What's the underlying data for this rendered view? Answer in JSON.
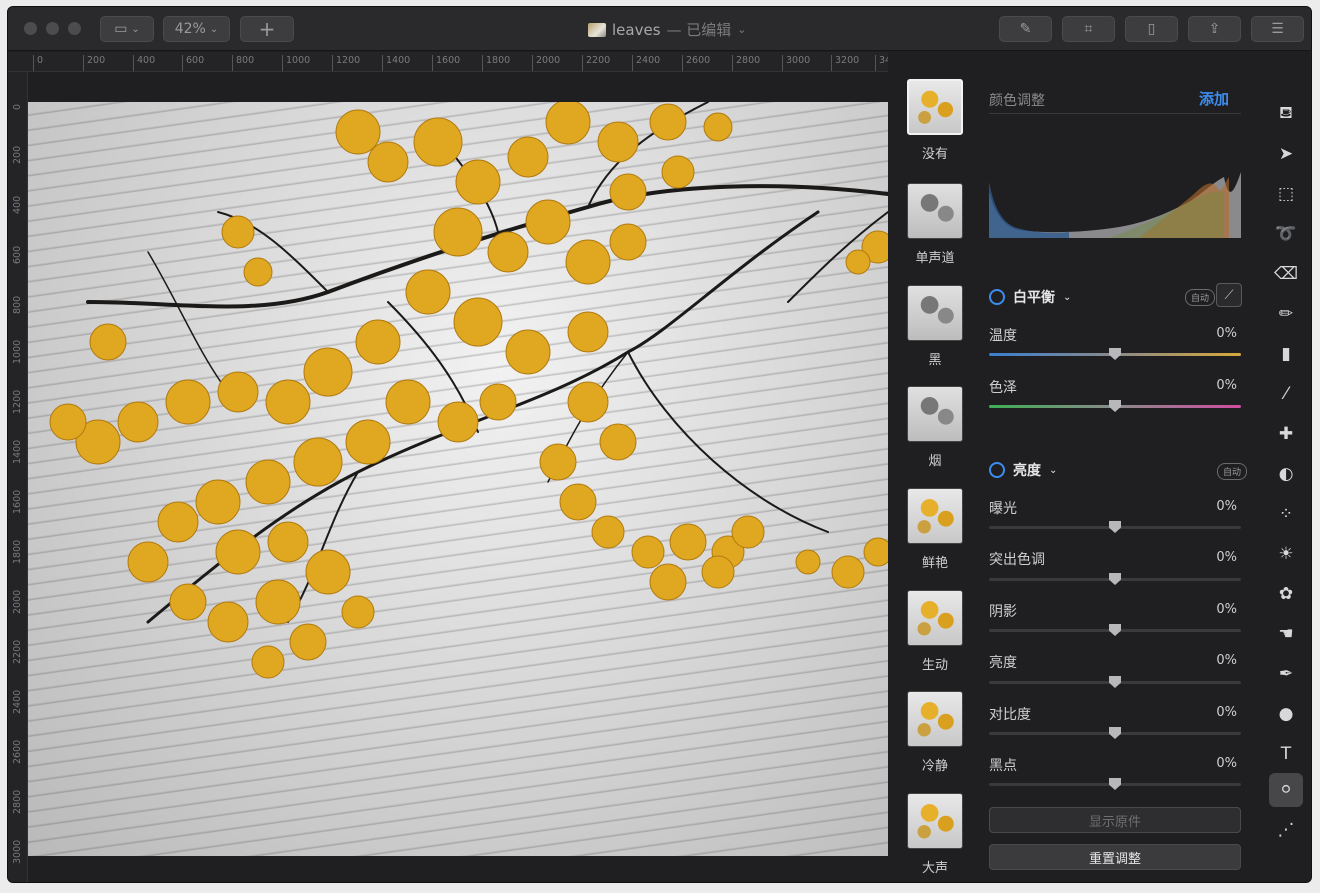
{
  "titlebar": {
    "zoom": "42%",
    "doc_name": "leaves",
    "doc_state": " — 已编辑",
    "add_label": "+"
  },
  "rulers": {
    "top": [
      "0",
      "200",
      "400",
      "600",
      "800",
      "1000",
      "1200",
      "1400",
      "1600",
      "1800",
      "2000",
      "2200",
      "2400",
      "2600",
      "2800",
      "3000",
      "3200",
      "34"
    ],
    "left": [
      "0",
      "200",
      "400",
      "600",
      "800",
      "1000",
      "1200",
      "1400",
      "1600",
      "1800",
      "2000",
      "2200",
      "2400",
      "2600",
      "2800",
      "3000"
    ]
  },
  "presets": [
    {
      "label": "没有",
      "style": "color",
      "selected": true
    },
    {
      "label": "单声道",
      "style": "gray",
      "selected": false
    },
    {
      "label": "黑",
      "style": "gray",
      "selected": false
    },
    {
      "label": "烟",
      "style": "gray",
      "selected": false
    },
    {
      "label": "鲜艳",
      "style": "color",
      "selected": false
    },
    {
      "label": "生动",
      "style": "color",
      "selected": false
    },
    {
      "label": "冷静",
      "style": "color",
      "selected": false
    },
    {
      "label": "大声",
      "style": "color",
      "selected": false
    }
  ],
  "panel": {
    "title": "颜色调整",
    "add": "添加",
    "white_balance": {
      "title": "白平衡",
      "auto": "自动",
      "sliders": [
        {
          "label": "温度",
          "value": "0%"
        },
        {
          "label": "色泽",
          "value": "0%"
        }
      ]
    },
    "brightness": {
      "title": "亮度",
      "auto": "自动",
      "sliders": [
        {
          "label": "曝光",
          "value": "0%"
        },
        {
          "label": "突出色调",
          "value": "0%"
        },
        {
          "label": "阴影",
          "value": "0%"
        },
        {
          "label": "亮度",
          "value": "0%"
        },
        {
          "label": "对比度",
          "value": "0%"
        },
        {
          "label": "黑点",
          "value": "0%"
        }
      ]
    },
    "show_original": "显示原件",
    "reset": "重置调整"
  },
  "colors": {
    "accent": "#3c8df0",
    "leaf": "#e0a820"
  },
  "tools": [
    "paint-bucket-icon",
    "arrow-select-icon",
    "rect-select-icon",
    "lasso-icon",
    "eraser-icon",
    "brush-icon",
    "fill-icon",
    "smudge-icon",
    "bandage-icon",
    "clone-icon",
    "blur-icon",
    "sun-icon",
    "color-mix-icon",
    "hand-retouch-icon",
    "pen-icon",
    "shape-icon",
    "text-icon",
    "color-adjust-icon",
    "noise-icon"
  ]
}
